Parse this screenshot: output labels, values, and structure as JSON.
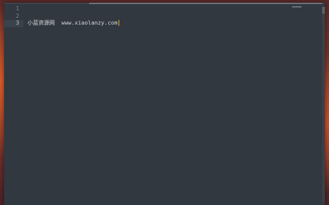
{
  "editor": {
    "line_numbers": [
      "1",
      "2",
      "3"
    ],
    "lines": [
      {
        "chinese": "",
        "text": ""
      },
      {
        "chinese": "",
        "text": ""
      },
      {
        "chinese": "小蓝资源网",
        "text": "  www.xiaolanzy.com"
      }
    ],
    "active_line": 3
  },
  "colors": {
    "editor_bg": "#313840",
    "cursor": "#f5a623",
    "text": "#d6dade",
    "line_number": "#7d858e"
  }
}
